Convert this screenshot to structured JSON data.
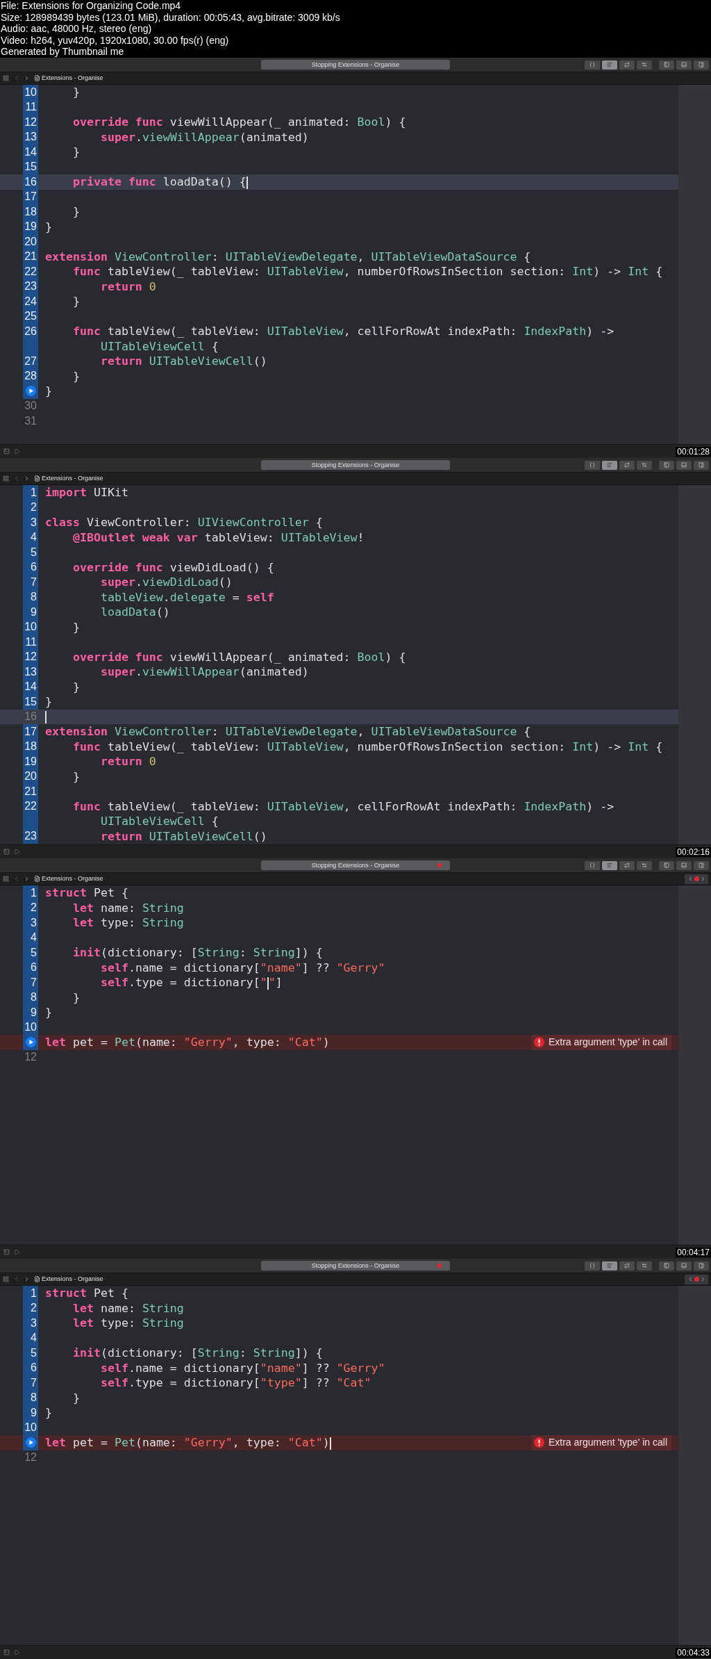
{
  "header": {
    "lines": [
      "File: Extensions for Organizing Code.mp4",
      "Size: 128989439 bytes (123.01 MiB), duration: 00:05:43, avg.bitrate: 3009 kb/s",
      "Audio: aac, 48000 Hz, stereo (eng)",
      "Video: h264, yuv420p, 1920x1080, 30.00 fps(r) (eng)",
      "Generated by Thumbnail me"
    ]
  },
  "frames": [
    {
      "toolbar_title": "Stopping Extensions - Organise",
      "title_error": false,
      "breadcrumb": "Extensions - Organise",
      "issue_navigator": false,
      "timestamp": "00:01:28",
      "lines": [
        {
          "kind": "line",
          "number": "10",
          "changed": true,
          "current": false,
          "segments": [
            {
              "kind": "plain",
              "text": "    }"
            }
          ]
        },
        {
          "kind": "line",
          "number": "11",
          "changed": true,
          "current": false
        },
        {
          "kind": "line",
          "number": "12",
          "changed": true,
          "current": false,
          "segments": [
            {
              "kind": "kw",
              "text": "    override func"
            },
            {
              "kind": "plain",
              "text": " viewWillAppear(_ animated: "
            },
            {
              "kind": "type",
              "text": "Bool"
            },
            {
              "kind": "plain",
              "text": ") {"
            }
          ]
        },
        {
          "kind": "line",
          "number": "13",
          "changed": true,
          "current": false,
          "segments": [
            {
              "kind": "kw",
              "text": "        super"
            },
            {
              "kind": "plain",
              "text": "."
            },
            {
              "kind": "type",
              "text": "viewWillAppear"
            },
            {
              "kind": "plain",
              "text": "(animated)"
            }
          ]
        },
        {
          "kind": "line",
          "number": "14",
          "changed": true,
          "current": false,
          "segments": [
            {
              "kind": "plain",
              "text": "    }"
            }
          ]
        },
        {
          "kind": "line",
          "number": "15",
          "changed": true,
          "current": false
        },
        {
          "kind": "line",
          "number": "16",
          "changed": true,
          "current": true,
          "segments": [
            {
              "kind": "kw",
              "text": "    private func"
            },
            {
              "kind": "plain",
              "text": " loadData() {"
            },
            {
              "kind": "cursor"
            }
          ]
        },
        {
          "kind": "line",
          "number": "17",
          "changed": true,
          "current": false
        },
        {
          "kind": "line",
          "number": "18",
          "changed": true,
          "current": false,
          "segments": [
            {
              "kind": "plain",
              "text": "    }"
            }
          ]
        },
        {
          "kind": "line",
          "number": "19",
          "changed": true,
          "current": false,
          "segments": [
            {
              "kind": "plain",
              "text": "}"
            }
          ]
        },
        {
          "kind": "line",
          "number": "20",
          "changed": true,
          "current": false
        },
        {
          "kind": "line",
          "number": "21",
          "changed": true,
          "current": false,
          "segments": [
            {
              "kind": "kw",
              "text": "extension"
            },
            {
              "kind": "type",
              "text": " ViewController"
            },
            {
              "kind": "plain",
              "text": ": "
            },
            {
              "kind": "type",
              "text": "UITableViewDelegate"
            },
            {
              "kind": "plain",
              "text": ", "
            },
            {
              "kind": "type",
              "text": "UITableViewDataSource"
            },
            {
              "kind": "plain",
              "text": " {"
            }
          ]
        },
        {
          "kind": "line",
          "number": "22",
          "changed": true,
          "current": false,
          "segments": [
            {
              "kind": "kw",
              "text": "    func"
            },
            {
              "kind": "plain",
              "text": " tableView(_ tableView: "
            },
            {
              "kind": "type",
              "text": "UITableView"
            },
            {
              "kind": "plain",
              "text": ", numberOfRowsInSection section: "
            },
            {
              "kind": "type",
              "text": "Int"
            },
            {
              "kind": "plain",
              "text": ") -> "
            },
            {
              "kind": "type",
              "text": "Int"
            },
            {
              "kind": "plain",
              "text": " {"
            }
          ]
        },
        {
          "kind": "line",
          "number": "23",
          "changed": true,
          "current": false,
          "segments": [
            {
              "kind": "kw",
              "text": "        return"
            },
            {
              "kind": "num",
              "text": " 0"
            }
          ]
        },
        {
          "kind": "line",
          "number": "24",
          "changed": true,
          "current": false,
          "segments": [
            {
              "kind": "plain",
              "text": "    }"
            }
          ]
        },
        {
          "kind": "line",
          "number": "25",
          "changed": true,
          "current": false
        },
        {
          "kind": "line",
          "number": "26",
          "changed": true,
          "current": false,
          "segments": [
            {
              "kind": "kw",
              "text": "    func"
            },
            {
              "kind": "plain",
              "text": " tableView(_ tableView: "
            },
            {
              "kind": "type",
              "text": "UITableView"
            },
            {
              "kind": "plain",
              "text": ", cellForRowAt indexPath: "
            },
            {
              "kind": "type",
              "text": "IndexPath"
            },
            {
              "kind": "plain",
              "text": ") ->"
            }
          ]
        },
        {
          "kind": "wrap",
          "changed": true,
          "current": false,
          "segments": [
            {
              "kind": "type",
              "text": "        UITableViewCell"
            },
            {
              "kind": "plain",
              "text": " {"
            }
          ]
        },
        {
          "kind": "line",
          "number": "27",
          "changed": true,
          "current": false,
          "segments": [
            {
              "kind": "kw",
              "text": "        return"
            },
            {
              "kind": "type",
              "text": " UITableViewCell"
            },
            {
              "kind": "plain",
              "text": "()"
            }
          ]
        },
        {
          "kind": "line",
          "number": "28",
          "changed": true,
          "current": false,
          "segments": [
            {
              "kind": "plain",
              "text": "    }"
            }
          ]
        },
        {
          "kind": "run",
          "changed": true,
          "current": false,
          "segments": [
            {
              "kind": "plain",
              "text": "}"
            }
          ]
        },
        {
          "kind": "line",
          "number": "30",
          "changed": false,
          "current": false
        },
        {
          "kind": "line",
          "number": "31",
          "changed": false,
          "current": false
        }
      ]
    },
    {
      "toolbar_title": "Stopping Extensions - Organise",
      "title_error": false,
      "breadcrumb": "Extensions - Organise",
      "issue_navigator": false,
      "timestamp": "00:02:16",
      "lines": [
        {
          "kind": "line",
          "number": "1",
          "changed": true,
          "current": false,
          "segments": [
            {
              "kind": "kw",
              "text": "import"
            },
            {
              "kind": "plain",
              "text": " UIKit"
            }
          ]
        },
        {
          "kind": "line",
          "number": "2",
          "changed": true,
          "current": false
        },
        {
          "kind": "line",
          "number": "3",
          "changed": true,
          "current": false,
          "segments": [
            {
              "kind": "kw",
              "text": "class"
            },
            {
              "kind": "plain",
              "text": " ViewController: "
            },
            {
              "kind": "type",
              "text": "UIViewController"
            },
            {
              "kind": "plain",
              "text": " {"
            }
          ]
        },
        {
          "kind": "line",
          "number": "4",
          "changed": true,
          "current": false,
          "segments": [
            {
              "kind": "kw",
              "text": "    @IBOutlet weak var"
            },
            {
              "kind": "plain",
              "text": " tableView: "
            },
            {
              "kind": "type",
              "text": "UITableView"
            },
            {
              "kind": "plain",
              "text": "!"
            }
          ]
        },
        {
          "kind": "line",
          "number": "5",
          "changed": true,
          "current": false
        },
        {
          "kind": "line",
          "number": "6",
          "changed": true,
          "current": false,
          "segments": [
            {
              "kind": "kw",
              "text": "    override func"
            },
            {
              "kind": "plain",
              "text": " viewDidLoad() {"
            }
          ]
        },
        {
          "kind": "line",
          "number": "7",
          "changed": true,
          "current": false,
          "segments": [
            {
              "kind": "kw",
              "text": "        super"
            },
            {
              "kind": "plain",
              "text": "."
            },
            {
              "kind": "type",
              "text": "viewDidLoad"
            },
            {
              "kind": "plain",
              "text": "()"
            }
          ]
        },
        {
          "kind": "line",
          "number": "8",
          "changed": true,
          "current": false,
          "segments": [
            {
              "kind": "type",
              "text": "        tableView"
            },
            {
              "kind": "plain",
              "text": "."
            },
            {
              "kind": "type",
              "text": "delegate"
            },
            {
              "kind": "plain",
              "text": " = "
            },
            {
              "kind": "kw",
              "text": "self"
            }
          ]
        },
        {
          "kind": "line",
          "number": "9",
          "changed": true,
          "current": false,
          "segments": [
            {
              "kind": "type",
              "text": "        loadData"
            },
            {
              "kind": "plain",
              "text": "()"
            }
          ]
        },
        {
          "kind": "line",
          "number": "10",
          "changed": true,
          "current": false,
          "segments": [
            {
              "kind": "plain",
              "text": "    }"
            }
          ]
        },
        {
          "kind": "line",
          "number": "11",
          "changed": true,
          "current": false
        },
        {
          "kind": "line",
          "number": "12",
          "changed": true,
          "current": false,
          "segments": [
            {
              "kind": "kw",
              "text": "    override func"
            },
            {
              "kind": "plain",
              "text": " viewWillAppear(_ animated: "
            },
            {
              "kind": "type",
              "text": "Bool"
            },
            {
              "kind": "plain",
              "text": ") {"
            }
          ]
        },
        {
          "kind": "line",
          "number": "13",
          "changed": true,
          "current": false,
          "segments": [
            {
              "kind": "kw",
              "text": "        super"
            },
            {
              "kind": "plain",
              "text": "."
            },
            {
              "kind": "type",
              "text": "viewWillAppear"
            },
            {
              "kind": "plain",
              "text": "(animated)"
            }
          ]
        },
        {
          "kind": "line",
          "number": "14",
          "changed": true,
          "current": false,
          "segments": [
            {
              "kind": "plain",
              "text": "    }"
            }
          ]
        },
        {
          "kind": "line",
          "number": "15",
          "changed": true,
          "current": false,
          "segments": [
            {
              "kind": "plain",
              "text": "}"
            }
          ]
        },
        {
          "kind": "line",
          "number": "16",
          "changed": false,
          "current": true,
          "segments": [
            {
              "kind": "cursor"
            }
          ]
        },
        {
          "kind": "line",
          "number": "17",
          "changed": true,
          "current": false,
          "segments": [
            {
              "kind": "kw",
              "text": "extension"
            },
            {
              "kind": "type",
              "text": " ViewController"
            },
            {
              "kind": "plain",
              "text": ": "
            },
            {
              "kind": "type",
              "text": "UITableViewDelegate"
            },
            {
              "kind": "plain",
              "text": ", "
            },
            {
              "kind": "type",
              "text": "UITableViewDataSource"
            },
            {
              "kind": "plain",
              "text": " {"
            }
          ]
        },
        {
          "kind": "line",
          "number": "18",
          "changed": true,
          "current": false,
          "segments": [
            {
              "kind": "kw",
              "text": "    func"
            },
            {
              "kind": "plain",
              "text": " tableView(_ tableView: "
            },
            {
              "kind": "type",
              "text": "UITableView"
            },
            {
              "kind": "plain",
              "text": ", numberOfRowsInSection section: "
            },
            {
              "kind": "type",
              "text": "Int"
            },
            {
              "kind": "plain",
              "text": ") -> "
            },
            {
              "kind": "type",
              "text": "Int"
            },
            {
              "kind": "plain",
              "text": " {"
            }
          ]
        },
        {
          "kind": "line",
          "number": "19",
          "changed": true,
          "current": false,
          "segments": [
            {
              "kind": "kw",
              "text": "        return"
            },
            {
              "kind": "num",
              "text": " 0"
            }
          ]
        },
        {
          "kind": "line",
          "number": "20",
          "changed": true,
          "current": false,
          "segments": [
            {
              "kind": "plain",
              "text": "    }"
            }
          ]
        },
        {
          "kind": "line",
          "number": "21",
          "changed": true,
          "current": false
        },
        {
          "kind": "line",
          "number": "22",
          "changed": true,
          "current": false,
          "segments": [
            {
              "kind": "kw",
              "text": "    func"
            },
            {
              "kind": "plain",
              "text": " tableView(_ tableView: "
            },
            {
              "kind": "type",
              "text": "UITableView"
            },
            {
              "kind": "plain",
              "text": ", cellForRowAt indexPath: "
            },
            {
              "kind": "type",
              "text": "IndexPath"
            },
            {
              "kind": "plain",
              "text": ") ->"
            }
          ]
        },
        {
          "kind": "wrap",
          "changed": true,
          "current": false,
          "segments": [
            {
              "kind": "type",
              "text": "        UITableViewCell"
            },
            {
              "kind": "plain",
              "text": " {"
            }
          ]
        },
        {
          "kind": "line",
          "number": "23",
          "changed": true,
          "current": false,
          "segments": [
            {
              "kind": "kw",
              "text": "        return"
            },
            {
              "kind": "type",
              "text": " UITableViewCell"
            },
            {
              "kind": "plain",
              "text": "()"
            }
          ]
        }
      ]
    },
    {
      "toolbar_title": "Stopping Extensions - Organise",
      "title_error": true,
      "breadcrumb": "Extensions - Organise",
      "issue_navigator": true,
      "timestamp": "00:04:17",
      "lines": [
        {
          "kind": "line",
          "number": "1",
          "changed": true,
          "current": false,
          "segments": [
            {
              "kind": "kw",
              "text": "struct"
            },
            {
              "kind": "plain",
              "text": " Pet {"
            }
          ]
        },
        {
          "kind": "line",
          "number": "2",
          "changed": true,
          "current": false,
          "segments": [
            {
              "kind": "kw",
              "text": "    let"
            },
            {
              "kind": "plain",
              "text": " name: "
            },
            {
              "kind": "type",
              "text": "String"
            }
          ]
        },
        {
          "kind": "line",
          "number": "3",
          "changed": true,
          "current": false,
          "segments": [
            {
              "kind": "kw",
              "text": "    let"
            },
            {
              "kind": "plain",
              "text": " type: "
            },
            {
              "kind": "type",
              "text": "String"
            }
          ]
        },
        {
          "kind": "line",
          "number": "4",
          "changed": true,
          "current": false
        },
        {
          "kind": "line",
          "number": "5",
          "changed": true,
          "current": false,
          "segments": [
            {
              "kind": "kw",
              "text": "    init"
            },
            {
              "kind": "plain",
              "text": "(dictionary: ["
            },
            {
              "kind": "type",
              "text": "String"
            },
            {
              "kind": "plain",
              "text": ": "
            },
            {
              "kind": "type",
              "text": "String"
            },
            {
              "kind": "plain",
              "text": "]) {"
            }
          ]
        },
        {
          "kind": "line",
          "number": "6",
          "changed": true,
          "current": false,
          "segments": [
            {
              "kind": "kw",
              "text": "        self"
            },
            {
              "kind": "plain",
              "text": ".name = dictionary["
            },
            {
              "kind": "str",
              "text": "\"name\""
            },
            {
              "kind": "plain",
              "text": "] ?? "
            },
            {
              "kind": "str",
              "text": "\"Gerry\""
            }
          ]
        },
        {
          "kind": "line",
          "number": "7",
          "changed": true,
          "current": false,
          "segments": [
            {
              "kind": "kw",
              "text": "        self"
            },
            {
              "kind": "plain",
              "text": ".type = dictionary["
            },
            {
              "kind": "str",
              "text": "\""
            },
            {
              "kind": "cursor"
            },
            {
              "kind": "str",
              "text": "\""
            },
            {
              "kind": "plain",
              "text": "]"
            }
          ]
        },
        {
          "kind": "line",
          "number": "8",
          "changed": true,
          "current": false,
          "segments": [
            {
              "kind": "plain",
              "text": "    }"
            }
          ]
        },
        {
          "kind": "line",
          "number": "9",
          "changed": true,
          "current": false,
          "segments": [
            {
              "kind": "plain",
              "text": "}"
            }
          ]
        },
        {
          "kind": "line",
          "number": "10",
          "changed": true,
          "current": false
        },
        {
          "kind": "run",
          "changed": true,
          "current": false,
          "error": "Extra argument 'type' in call",
          "segments": [
            {
              "kind": "kw",
              "text": "let"
            },
            {
              "kind": "plain",
              "text": " pet = "
            },
            {
              "kind": "type",
              "text": "Pet"
            },
            {
              "kind": "plain",
              "text": "(name: "
            },
            {
              "kind": "str",
              "text": "\"Gerry\""
            },
            {
              "kind": "plain",
              "text": ", type: "
            },
            {
              "kind": "str",
              "text": "\"Cat\""
            },
            {
              "kind": "plain",
              "text": ")"
            }
          ]
        },
        {
          "kind": "line",
          "number": "12",
          "changed": false,
          "current": false
        }
      ]
    },
    {
      "toolbar_title": "Stopping Extensions - Organise",
      "title_error": true,
      "breadcrumb": "Extensions - Organise",
      "issue_navigator": true,
      "timestamp": "00:04:33",
      "lines": [
        {
          "kind": "line",
          "number": "1",
          "changed": true,
          "current": false,
          "segments": [
            {
              "kind": "kw",
              "text": "struct"
            },
            {
              "kind": "plain",
              "text": " Pet {"
            }
          ]
        },
        {
          "kind": "line",
          "number": "2",
          "changed": true,
          "current": false,
          "segments": [
            {
              "kind": "kw",
              "text": "    let"
            },
            {
              "kind": "plain",
              "text": " name: "
            },
            {
              "kind": "type",
              "text": "String"
            }
          ]
        },
        {
          "kind": "line",
          "number": "3",
          "changed": true,
          "current": false,
          "segments": [
            {
              "kind": "kw",
              "text": "    let"
            },
            {
              "kind": "plain",
              "text": " type: "
            },
            {
              "kind": "type",
              "text": "String"
            }
          ]
        },
        {
          "kind": "line",
          "number": "4",
          "changed": true,
          "current": false
        },
        {
          "kind": "line",
          "number": "5",
          "changed": true,
          "current": false,
          "segments": [
            {
              "kind": "kw",
              "text": "    init"
            },
            {
              "kind": "plain",
              "text": "(dictionary: ["
            },
            {
              "kind": "type",
              "text": "String"
            },
            {
              "kind": "plain",
              "text": ": "
            },
            {
              "kind": "type",
              "text": "String"
            },
            {
              "kind": "plain",
              "text": "]) {"
            }
          ]
        },
        {
          "kind": "line",
          "number": "6",
          "changed": true,
          "current": false,
          "segments": [
            {
              "kind": "kw",
              "text": "        self"
            },
            {
              "kind": "plain",
              "text": ".name = dictionary["
            },
            {
              "kind": "str",
              "text": "\"name\""
            },
            {
              "kind": "plain",
              "text": "] ?? "
            },
            {
              "kind": "str",
              "text": "\"Gerry\""
            }
          ]
        },
        {
          "kind": "line",
          "number": "7",
          "changed": true,
          "current": false,
          "segments": [
            {
              "kind": "kw",
              "text": "        self"
            },
            {
              "kind": "plain",
              "text": ".type = dictionary["
            },
            {
              "kind": "str",
              "text": "\"type\""
            },
            {
              "kind": "plain",
              "text": "] ?? "
            },
            {
              "kind": "str",
              "text": "\"Cat\""
            }
          ]
        },
        {
          "kind": "line",
          "number": "8",
          "changed": true,
          "current": false,
          "segments": [
            {
              "kind": "plain",
              "text": "    }"
            }
          ]
        },
        {
          "kind": "line",
          "number": "9",
          "changed": true,
          "current": false,
          "segments": [
            {
              "kind": "plain",
              "text": "}"
            }
          ]
        },
        {
          "kind": "line",
          "number": "10",
          "changed": true,
          "current": false
        },
        {
          "kind": "run",
          "changed": true,
          "current": false,
          "error": "Extra argument 'type' in call",
          "segments": [
            {
              "kind": "kw",
              "text": "let"
            },
            {
              "kind": "plain",
              "text": " pet = "
            },
            {
              "kind": "type",
              "text": "Pet"
            },
            {
              "kind": "plain",
              "text": "(name: "
            },
            {
              "kind": "str",
              "text": "\"Gerry\""
            },
            {
              "kind": "plain",
              "text": ", type: "
            },
            {
              "kind": "str",
              "text": "\"Cat\""
            },
            {
              "kind": "plain",
              "text": ")"
            },
            {
              "kind": "cursor"
            }
          ]
        },
        {
          "kind": "line",
          "number": "12",
          "changed": false,
          "current": false
        }
      ]
    }
  ]
}
